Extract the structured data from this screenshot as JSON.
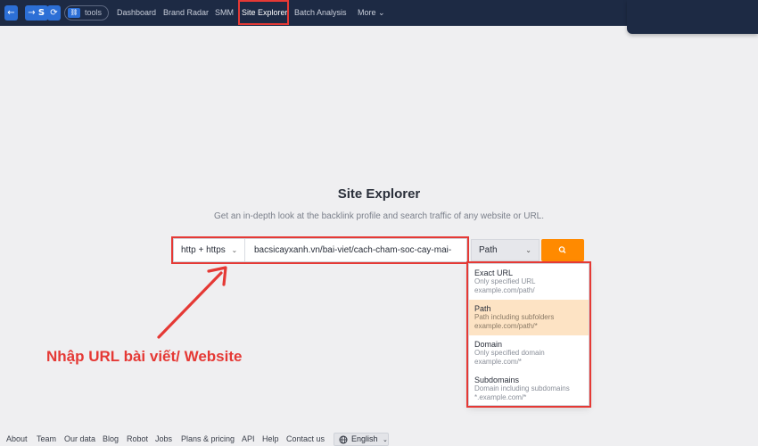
{
  "nav": {
    "back_icon": "←",
    "forward_icon": "→",
    "tools_label": "tools",
    "links": [
      "Dashboard",
      "Brand Radar",
      "SMM",
      "Site Explorer",
      "Batch Analysis",
      "More ⌄"
    ],
    "active": "Site Explorer"
  },
  "hero": {
    "title": "Site Explorer",
    "subtitle": "Get an in-depth look at the backlink profile and search traffic of any website or URL."
  },
  "search": {
    "protocol": "http + https",
    "url_value": "bacsicayxanh.vn/bai-viet/cach-cham-soc-cay-mai-",
    "mode": "Path",
    "button_icon": "search-icon"
  },
  "mode_options": [
    {
      "title": "Exact URL",
      "desc": "Only specified URL",
      "example": "example.com/path/"
    },
    {
      "title": "Path",
      "desc": "Path including subfolders",
      "example": "example.com/path/*"
    },
    {
      "title": "Domain",
      "desc": "Only specified domain",
      "example": "example.com/*"
    },
    {
      "title": "Subdomains",
      "desc": "Domain including subdomains",
      "example": "*.example.com/*"
    }
  ],
  "annotation": "Nhập URL bài viết/ Website",
  "footer": {
    "links": [
      "About",
      "Team",
      "Our data",
      "Blog",
      "Robot",
      "Jobs",
      "Plans & pricing",
      "API",
      "Help",
      "Contact us"
    ],
    "language": "English"
  },
  "colors": {
    "accent": "#ff8a00",
    "nav_bg": "#1d2a44",
    "highlight": "#e53935",
    "selected_option": "#fde3c4"
  }
}
